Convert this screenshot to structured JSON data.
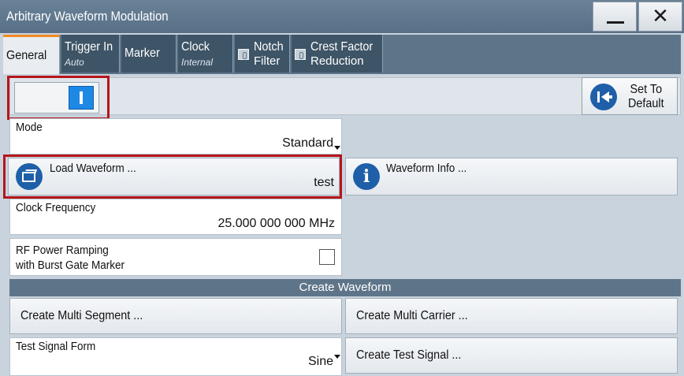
{
  "window": {
    "title": "Arbitrary Waveform Modulation",
    "minimize_label": "—",
    "close_label": "✕"
  },
  "tabs": [
    {
      "label": "General",
      "sub": "",
      "has_led": false
    },
    {
      "label": "Trigger In",
      "sub": "Auto",
      "has_led": false
    },
    {
      "label": "Marker",
      "sub": "",
      "has_led": false
    },
    {
      "label": "Clock",
      "sub": "Internal",
      "has_led": false
    },
    {
      "label": "Notch",
      "sub": "Filter",
      "has_led": true
    },
    {
      "label": "Crest Factor",
      "sub": "Reduction",
      "has_led": true
    }
  ],
  "state": {
    "toggle_on": true
  },
  "set_to_default": {
    "line1": "Set To",
    "line2": "Default"
  },
  "mode": {
    "label": "Mode",
    "value": "Standard"
  },
  "load_waveform": {
    "label": "Load Waveform ...",
    "value": "test"
  },
  "waveform_info": {
    "label": "Waveform Info ..."
  },
  "clock_frequency": {
    "label": "Clock Frequency",
    "value": "25.000 000 000 MHz"
  },
  "rf_power_ramping": {
    "label_line1": "RF Power Ramping",
    "label_line2": "with Burst Gate Marker",
    "checked": false
  },
  "create_waveform": {
    "header": "Create Waveform",
    "multi_segment": "Create Multi Segment ...",
    "multi_carrier": "Create Multi Carrier ...",
    "test_signal_form_label": "Test Signal Form",
    "test_signal_form_value": "Sine",
    "test_signal": "Create Test Signal ..."
  },
  "colors": {
    "title_bar": "#587087",
    "tab_bg": "#3e5467",
    "active_tab_accent": "#f08a24",
    "highlight_red": "#b5161b",
    "icon_blue": "#1f5fa8",
    "toggle_blue": "#1e88e5"
  }
}
